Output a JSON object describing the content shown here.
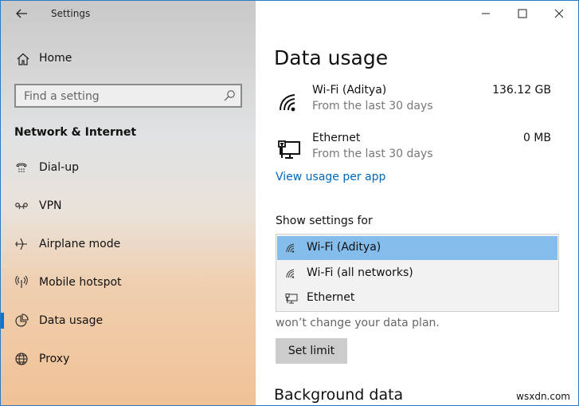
{
  "window": {
    "app_title": "Settings",
    "back_icon": "back-arrow-icon",
    "caption_buttons": [
      "minimize",
      "maximize",
      "close"
    ]
  },
  "sidebar": {
    "home_label": "Home",
    "search": {
      "placeholder": "Find a setting",
      "value": ""
    },
    "section_title": "Network & Internet",
    "items": [
      {
        "label": "Dial-up",
        "icon": "dial-up-icon"
      },
      {
        "label": "VPN",
        "icon": "vpn-icon"
      },
      {
        "label": "Airplane mode",
        "icon": "airplane-icon"
      },
      {
        "label": "Mobile hotspot",
        "icon": "hotspot-icon"
      },
      {
        "label": "Data usage",
        "icon": "data-usage-icon",
        "active": true
      },
      {
        "label": "Proxy",
        "icon": "globe-icon"
      }
    ],
    "accent_color": "#0078d7"
  },
  "main": {
    "title": "Data usage",
    "networks": [
      {
        "name": "Wi-Fi (Aditya)",
        "sub": "From the last 30 days",
        "amount": "136.12 GB",
        "icon": "wifi-icon"
      },
      {
        "name": "Ethernet",
        "sub": "From the last 30 days",
        "amount": "0 MB",
        "icon": "ethernet-icon"
      }
    ],
    "view_usage_link": "View usage per app",
    "show_settings_for_label": "Show settings for",
    "dropdown_options": [
      {
        "label": "Wi-Fi (Aditya)",
        "icon": "wifi-icon",
        "selected": true
      },
      {
        "label": "Wi-Fi (all networks)",
        "icon": "wifi-icon",
        "selected": false
      },
      {
        "label": "Ethernet",
        "icon": "ethernet-icon",
        "selected": false
      }
    ],
    "note_text": "won’t change your data plan.",
    "set_limit_button": "Set limit",
    "background_data_heading": "Background data",
    "link_color": "#0067b8",
    "selected_color": "#84bdeb"
  },
  "watermark": "wsxdn.com"
}
